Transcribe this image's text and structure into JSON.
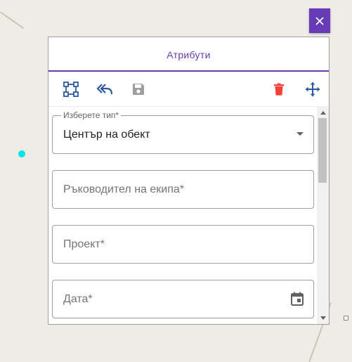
{
  "colors": {
    "accent": "#673ab7",
    "delete": "#f44336",
    "tool_blue": "#2c5aa0",
    "point": "#00e5e5"
  },
  "close_button": {
    "icon": "close-icon",
    "label": "✕"
  },
  "panel": {
    "tab": {
      "label": "Атрибути"
    },
    "toolbar": {
      "icons": [
        "edit-geometry-icon",
        "undo-icon",
        "save-icon",
        "delete-icon",
        "move-icon"
      ]
    },
    "fields": {
      "type": {
        "legend": "Изберете тип*",
        "value": "Център на обект"
      },
      "team_lead": {
        "placeholder": "Ръководител на екипа*"
      },
      "project": {
        "placeholder": "Проект*"
      },
      "date": {
        "placeholder": "Дата*",
        "icon": "calendar-icon"
      }
    }
  }
}
